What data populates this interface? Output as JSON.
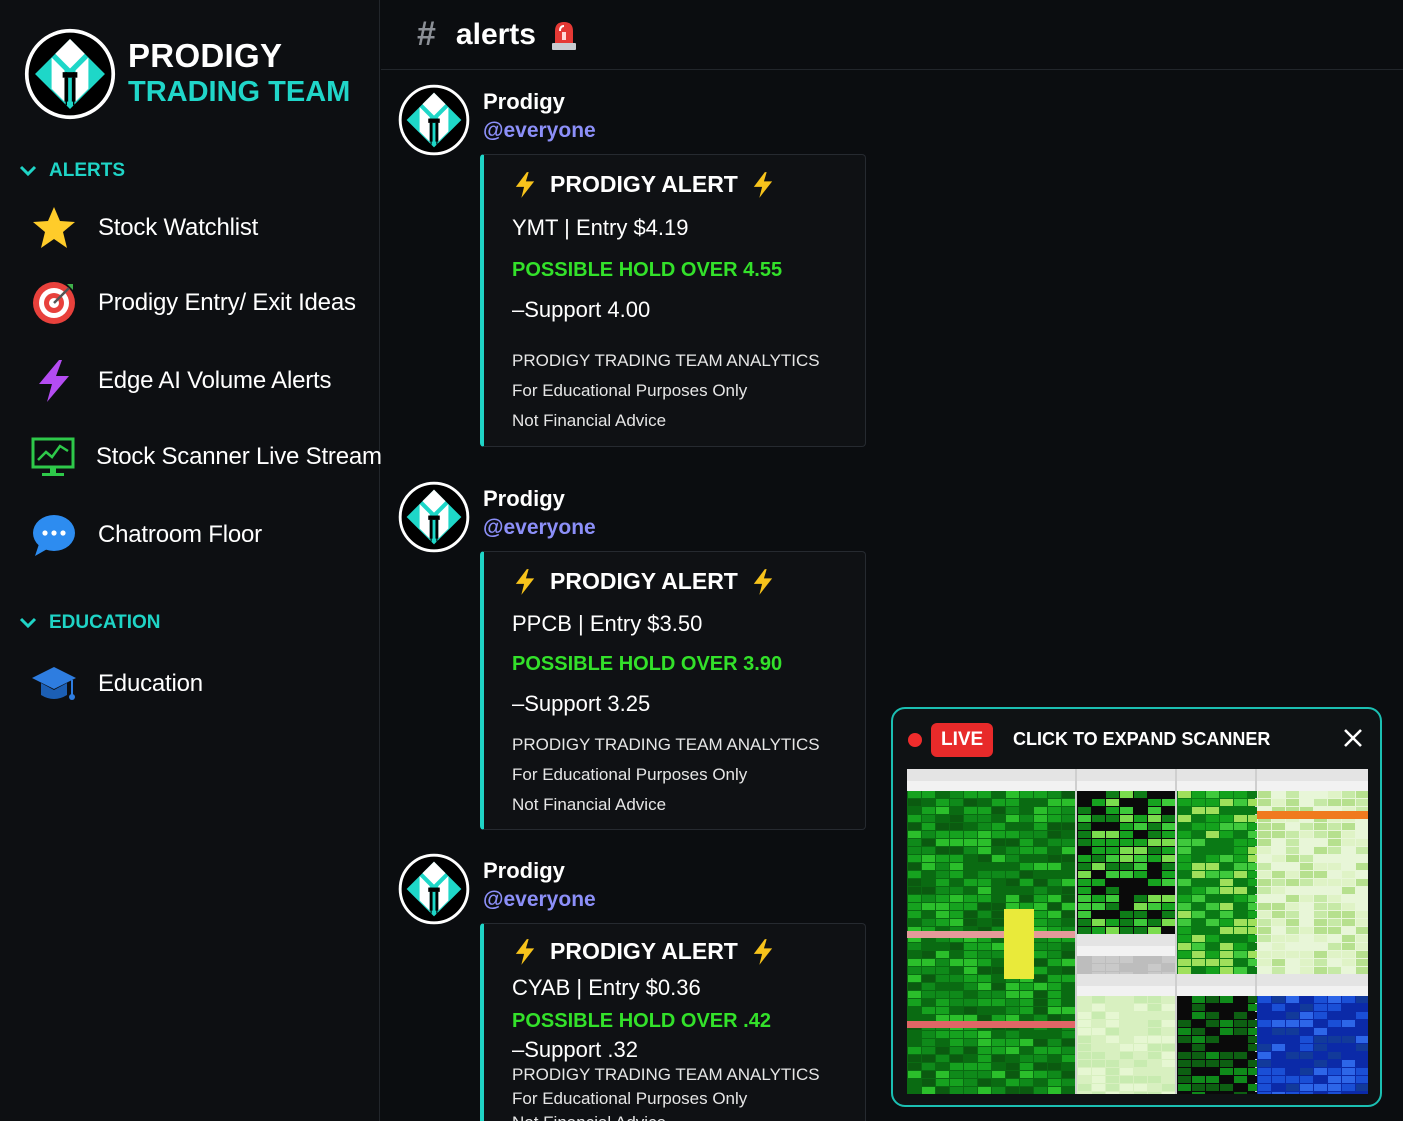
{
  "brand": {
    "line1": "PRODIGY",
    "line2": "TRADING TEAM",
    "logo_icon": "prodigy-logo-icon"
  },
  "sidebar": {
    "sections": [
      {
        "label": "ALERTS"
      },
      {
        "label": "EDUCATION"
      }
    ],
    "items": [
      {
        "label": "Stock Watchlist",
        "icon": "star-icon"
      },
      {
        "label": "Prodigy Entry/ Exit Ideas",
        "icon": "target-icon"
      },
      {
        "label": "Edge AI Volume Alerts",
        "icon": "lightning-icon"
      },
      {
        "label": "Stock Scanner Live Stream",
        "icon": "monitor-chart-icon"
      },
      {
        "label": "Chatroom Floor",
        "icon": "chat-bubble-icon"
      },
      {
        "label": "Education",
        "icon": "graduation-cap-icon"
      }
    ]
  },
  "header": {
    "hash": "#",
    "channel": "alerts",
    "icon": "siren-icon"
  },
  "messages": [
    {
      "author": "Prodigy",
      "mention": "@everyone",
      "alert_title": "PRODIGY ALERT",
      "entry": "YMT | Entry $4.19",
      "hold": "POSSIBLE HOLD OVER 4.55",
      "support": "–Support 4.00",
      "footer1": "PRODIGY TRADING TEAM ANALYTICS",
      "footer2": "For Educational Purposes Only",
      "footer3": "Not Financial Advice"
    },
    {
      "author": "Prodigy",
      "mention": "@everyone",
      "alert_title": "PRODIGY ALERT",
      "entry": "PPCB | Entry $3.50",
      "hold": "POSSIBLE HOLD OVER 3.90",
      "support": "–Support 3.25",
      "footer1": "PRODIGY TRADING TEAM ANALYTICS",
      "footer2": "For Educational Purposes Only",
      "footer3": "Not Financial Advice"
    },
    {
      "author": "Prodigy",
      "mention": "@everyone",
      "alert_title": "PRODIGY ALERT",
      "entry": "CYAB | Entry $0.36",
      "hold": "POSSIBLE HOLD OVER .42",
      "support": "–Support .32",
      "footer1": "PRODIGY TRADING TEAM ANALYTICS",
      "footer2": "For Educational Purposes Only",
      "footer3": "Not Financial Advice"
    }
  ],
  "scanner": {
    "live_label": "LIVE",
    "expand_label": "CLICK TO EXPAND SCANNER",
    "close_icon": "close-icon",
    "accent": "#1bbfb2"
  },
  "colors": {
    "accent": "#1fd4c6",
    "hold_green": "#33e12a",
    "mention": "#8c8ff8",
    "live_red": "#e82a2a"
  }
}
